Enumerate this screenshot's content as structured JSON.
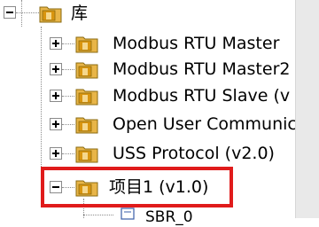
{
  "tree": {
    "root": {
      "label": "库",
      "icon": "folder-icon",
      "expander": "minus"
    },
    "libraries": [
      {
        "label": "Modbus RTU Master",
        "icon": "library-folder-icon",
        "expander": "plus"
      },
      {
        "label": "Modbus RTU Master2",
        "icon": "library-folder-icon",
        "expander": "plus"
      },
      {
        "label": "Modbus RTU Slave (v",
        "icon": "library-folder-icon",
        "expander": "plus"
      },
      {
        "label": "Open User Communic",
        "icon": "library-folder-icon",
        "expander": "plus"
      },
      {
        "label": "USS Protocol (v2.0)",
        "icon": "library-folder-icon",
        "expander": "plus"
      },
      {
        "label": "项目1 (v1.0)",
        "icon": "library-folder-icon",
        "expander": "minus",
        "highlighted": true
      }
    ],
    "child": {
      "label": "SBR_0",
      "icon": "subroutine-icon"
    }
  },
  "colors": {
    "highlight": "#e01b1b",
    "folder": "#e8b548",
    "folder_inner": "#d9950f"
  }
}
